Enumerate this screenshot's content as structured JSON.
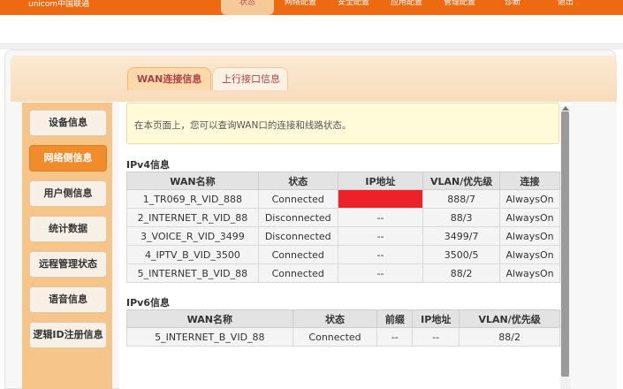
{
  "header": {
    "brand": "unicom中国联通",
    "nav": [
      "状态",
      "网络配置",
      "安全配置",
      "应用配置",
      "管理配置",
      "诊断",
      "退出"
    ]
  },
  "tabs": [
    {
      "label": "WAN连接信息",
      "active": true
    },
    {
      "label": "上行接口信息",
      "active": false
    }
  ],
  "sidebar": {
    "items": [
      {
        "label": "设备信息",
        "active": false
      },
      {
        "label": "网络侧信息",
        "active": true
      },
      {
        "label": "用户侧信息",
        "active": false
      },
      {
        "label": "统计数据",
        "active": false
      },
      {
        "label": "远程管理状态",
        "active": false
      },
      {
        "label": "语音信息",
        "active": false
      },
      {
        "label": "逻辑ID注册信息",
        "active": false
      }
    ]
  },
  "notice": "在本页面上，您可以查询WAN口的连接和线路状态。",
  "ipv4": {
    "title": "IPv4信息",
    "headers": [
      "WAN名称",
      "状态",
      "IP地址",
      "VLAN/优先级",
      "连接"
    ],
    "rows": [
      [
        "1_TR069_R_VID_888",
        "Connected",
        "",
        "888/7",
        "AlwaysOn"
      ],
      [
        "2_INTERNET_R_VID_88",
        "Disconnected",
        "--",
        "88/3",
        "AlwaysOn"
      ],
      [
        "3_VOICE_R_VID_3499",
        "Disconnected",
        "--",
        "3499/7",
        "AlwaysOn"
      ],
      [
        "4_IPTV_B_VID_3500",
        "Connected",
        "--",
        "3500/5",
        "AlwaysOn"
      ],
      [
        "5_INTERNET_B_VID_88",
        "Connected",
        "--",
        "88/2",
        "AlwaysOn"
      ]
    ]
  },
  "ipv6": {
    "title": "IPv6信息",
    "headers": [
      "WAN名称",
      "状态",
      "前缀",
      "IP地址",
      "VLAN/优先级"
    ],
    "rows": [
      [
        "5_INTERNET_B_VID_88",
        "Connected",
        "--",
        "--",
        "88/2"
      ]
    ]
  },
  "colors": {
    "accent": "#ee6a12",
    "sidebar": "#f6c58a",
    "redaction": "#ec2228"
  }
}
